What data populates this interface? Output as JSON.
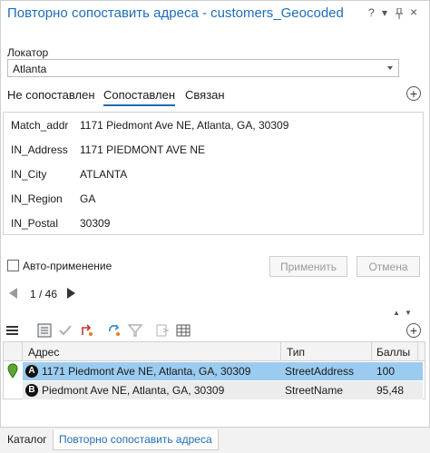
{
  "pane": {
    "title": "Повторно сопоставить адреса - customers_Geocoded",
    "help_icon": "?",
    "menu_icon": "▾",
    "pin_icon": "pin",
    "close_icon": "×"
  },
  "locator": {
    "label": "Локатор",
    "value": "Atlanta"
  },
  "tabs": [
    {
      "label": "Не сопоставлен",
      "active": false
    },
    {
      "label": "Сопоставлен",
      "active": true
    },
    {
      "label": "Связан",
      "active": false
    }
  ],
  "fields": [
    {
      "name": "Match_addr",
      "value": "1171 Piedmont Ave NE, Atlanta, GA, 30309"
    },
    {
      "name": "IN_Address",
      "value": "1171 PIEDMONT AVE NE"
    },
    {
      "name": "IN_City",
      "value": "ATLANTA"
    },
    {
      "name": "IN_Region",
      "value": "GA"
    },
    {
      "name": "IN_Postal",
      "value": "30309"
    }
  ],
  "options": {
    "auto_apply_label": "Авто-применение",
    "apply_button": "Применить",
    "cancel_button": "Отмена"
  },
  "pager": {
    "text": "1 / 46"
  },
  "candidates": {
    "columns": [
      "Адрес",
      "Тип",
      "Баллы"
    ],
    "rows": [
      {
        "badge": "A",
        "address": "1171 Piedmont Ave NE, Atlanta, GA, 30309",
        "type": "StreetAddress",
        "score": "100",
        "selected": true
      },
      {
        "badge": "B",
        "address": "Piedmont Ave NE, Atlanta, GA, 30309",
        "type": "StreetName",
        "score": "95,48",
        "selected": false
      }
    ]
  },
  "bottom_tabs": [
    {
      "label": "Каталог",
      "active": false
    },
    {
      "label": "Повторно сопоставить адреса",
      "active": true
    }
  ],
  "colors": {
    "accent": "#1f6db5",
    "selection": "#9ccbf0"
  }
}
